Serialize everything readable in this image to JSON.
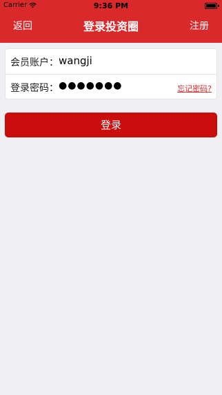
{
  "status_bar": {
    "carrier": "Carrier",
    "time": "9:36 PM"
  },
  "nav": {
    "back_label": "返回",
    "title": "登录投资圈",
    "register_label": "注册"
  },
  "form": {
    "account_label": "会员账户：",
    "account_value": "wangji",
    "password_label": "登录密码：",
    "password_value": "●●●●●●●",
    "forgot_label": "忘记密码?"
  },
  "login_button": "登录",
  "colors": {
    "brand_red": "#d9292b",
    "button_red": "#c90d0d",
    "background": "#efeff4"
  }
}
